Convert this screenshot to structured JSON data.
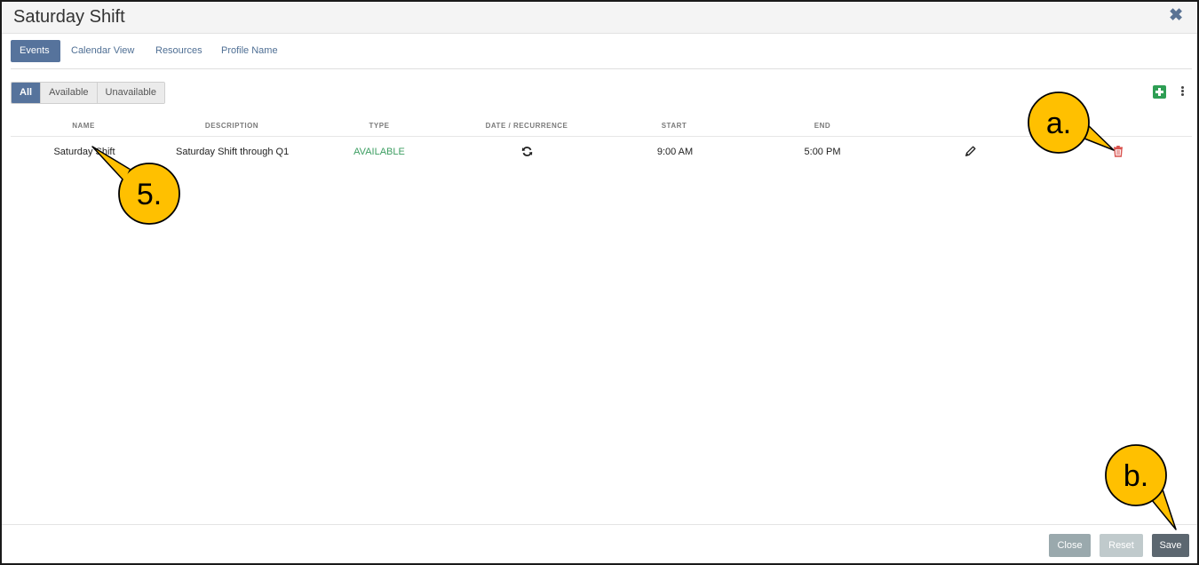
{
  "dialog": {
    "title": "Saturday Shift"
  },
  "tabs": [
    {
      "label": "Events"
    },
    {
      "label": "Calendar View"
    },
    {
      "label": "Resources"
    },
    {
      "label": "Profile Name"
    }
  ],
  "filters": [
    {
      "label": "All"
    },
    {
      "label": "Available"
    },
    {
      "label": "Unavailable"
    }
  ],
  "table": {
    "columns": [
      "NAME",
      "DESCRIPTION",
      "TYPE",
      "DATE / RECURRENCE",
      "START",
      "END"
    ],
    "rows": [
      {
        "name": "Saturday Shift",
        "description": "Saturday Shift through Q1",
        "type": "AVAILABLE",
        "recurrence_icon": "recurrence-icon",
        "start": "9:00 AM",
        "end": "5:00 PM"
      }
    ]
  },
  "footer": {
    "close_label": "Close",
    "reset_label": "Reset",
    "save_label": "Save"
  },
  "annotations": {
    "callout_5": "5.",
    "callout_a": "a.",
    "callout_b": "b."
  },
  "colors": {
    "accent": "#56739c",
    "available": "#3d9e62",
    "add": "#2e9e54",
    "delete": "#d9534f",
    "callout": "#ffc000"
  }
}
